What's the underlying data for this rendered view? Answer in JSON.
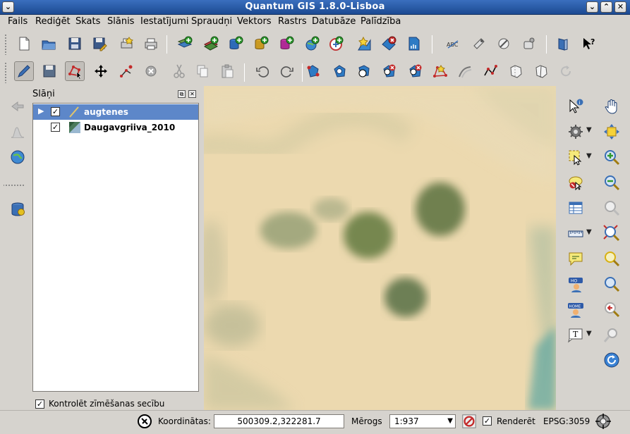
{
  "window": {
    "title": "Quantum GIS 1.8.0-Lisboa",
    "menu_glyph": "⌄",
    "minimize_glyph": "⌄",
    "maximize_glyph": "⌃",
    "close_glyph": "✕"
  },
  "menu": {
    "items": [
      "Fails",
      "Rediģēt",
      "Skats",
      "Slānis",
      "Iestatījumi",
      "Spraudņi",
      "Vektors",
      "Rastrs",
      "Datubāze",
      "Palīdzība"
    ]
  },
  "layers_panel": {
    "title": "Slāņi",
    "layers": [
      {
        "name": "augtenes",
        "checked": true,
        "selected": true
      },
      {
        "name": "Daugavgriiva_2010",
        "checked": true,
        "selected": false
      }
    ],
    "check_glyph": "✓",
    "expand_glyph": "▶",
    "float_glyph": "⧉",
    "close_glyph": "✕",
    "draw_order_label": "Kontrolēt zīmēšanas secību",
    "draw_order_checked": true
  },
  "statusbar": {
    "coordinates_label": "Koordinātas:",
    "coordinates_value": "500309.2,322281.7",
    "scale_label": "Mērogs",
    "scale_value": "1:937",
    "render_label": "Renderēt",
    "render_checked": true,
    "crs": "EPSG:3059"
  },
  "colors": {
    "titlebar": "#1c4a92",
    "selection": "#5d87c9",
    "map_base": "#ead6ac",
    "vegetation": "#7e8a62"
  },
  "icons": {
    "file_toolbar": [
      "new-project-icon",
      "open-project-icon",
      "save-project-icon",
      "save-as-icon",
      "new-print-composer-icon",
      "print-icon",
      "add-raster-layer-icon",
      "add-wms-layer-icon",
      "add-postgis-layer-icon",
      "add-spatialite-layer-icon",
      "add-mssql-layer-icon",
      "add-wfs-layer-icon",
      "add-wcs-layer-icon",
      "new-shapefile-layer-icon",
      "remove-layer-icon",
      "add-delimited-text-icon",
      "label-icon",
      "plugin-tool-1-icon",
      "plugin-tool-2-icon",
      "plugin-tool-3-icon",
      "help-book-icon",
      "whats-this-icon"
    ],
    "edit_toolbar": [
      "toggle-editing-icon",
      "save-edits-icon",
      "node-tool-icon",
      "move-feature-icon",
      "add-feature-icon",
      "delete-selected-icon",
      "cut-icon",
      "copy-icon",
      "paste-icon",
      "undo-icon",
      "redo-icon",
      "simplify-icon",
      "add-ring-icon",
      "add-part-icon",
      "delete-ring-icon",
      "delete-part-icon",
      "reshape-icon",
      "offset-curve-icon",
      "split-features-icon",
      "merge-features-icon",
      "merge-attributes-icon",
      "rotate-point-icon"
    ]
  }
}
